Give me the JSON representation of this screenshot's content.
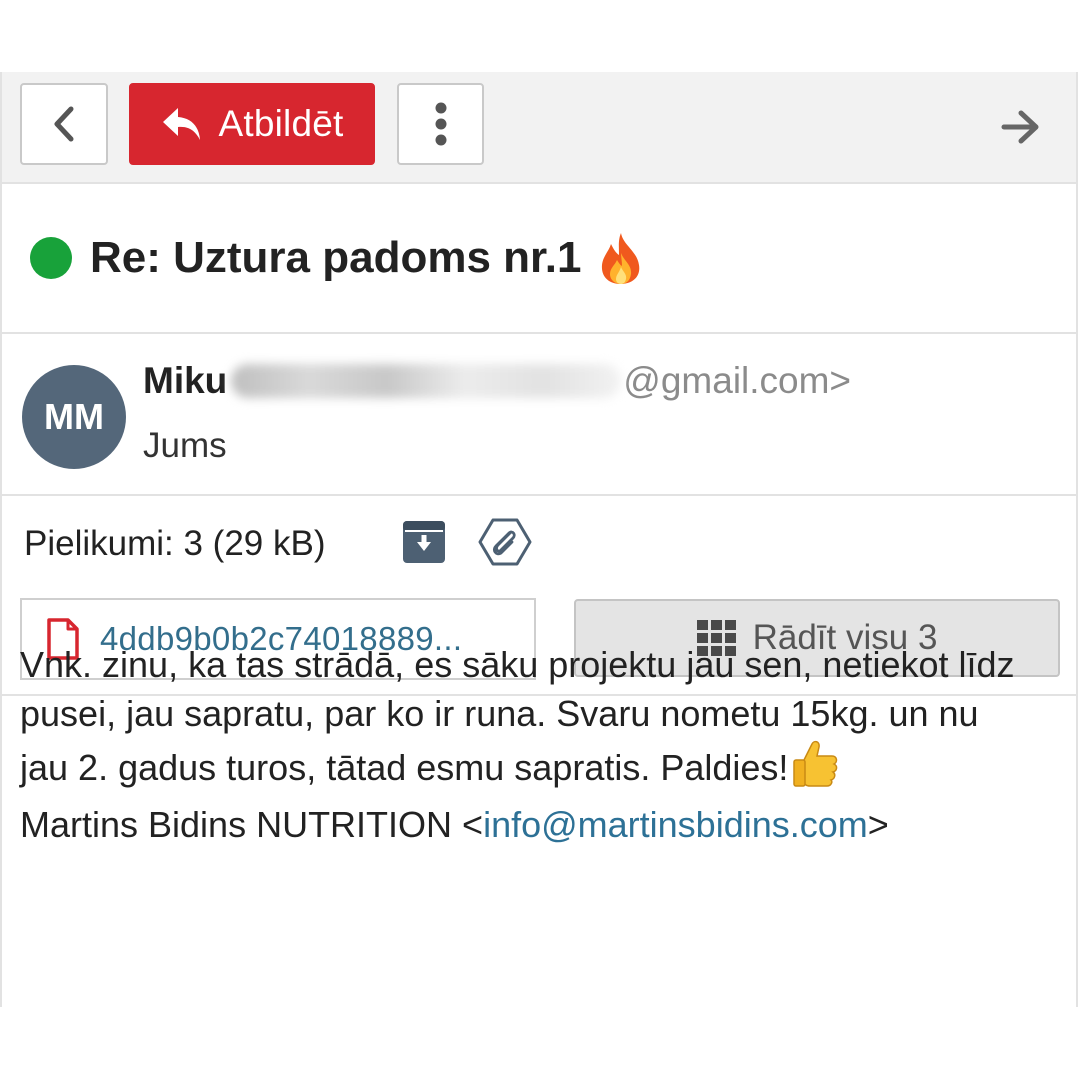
{
  "toolbar": {
    "back_icon": "chevron-left-icon",
    "reply_label": "Atbildēt",
    "reply_icon": "reply-icon",
    "more_icon": "vertical-dots-icon",
    "forward_icon": "arrow-right-icon",
    "reply_color": "#d7262f"
  },
  "message": {
    "status_color": "#18a23a",
    "subject": "Re: Uztura padoms nr.1",
    "subject_emoji": "fire-icon",
    "sender": {
      "initials": "MM",
      "name_visible": "Miku",
      "email_visible": "@gmail.com>",
      "recipient": "Jums",
      "avatar_color": "#54677a"
    }
  },
  "attachments": {
    "label": "Pielikumi: 3 (29 kB)",
    "download_icon": "archive-download-icon",
    "clip_icon": "paperclip-icon",
    "first_file": "4ddb9b0b2c74018889...",
    "file_icon": "pdf-file-icon",
    "show_all_label": "Rādīt visu 3",
    "show_all_icon": "grid-icon"
  },
  "body": {
    "paragraph": "Vnk. zinu, ka tas strādā, es sāku projektu jau sen, netiekot līdz pusei, jau sapratu, par ko ir runa. Svaru nometu 15kg. un nu jau 2. gadus turos, tātad esmu sapratis. Paldies!",
    "emoji": "thumbs-up-icon",
    "signature_name": "Martins Bidins NUTRITION <",
    "signature_email": "info@martinsbidins.com",
    "signature_end": ">"
  }
}
